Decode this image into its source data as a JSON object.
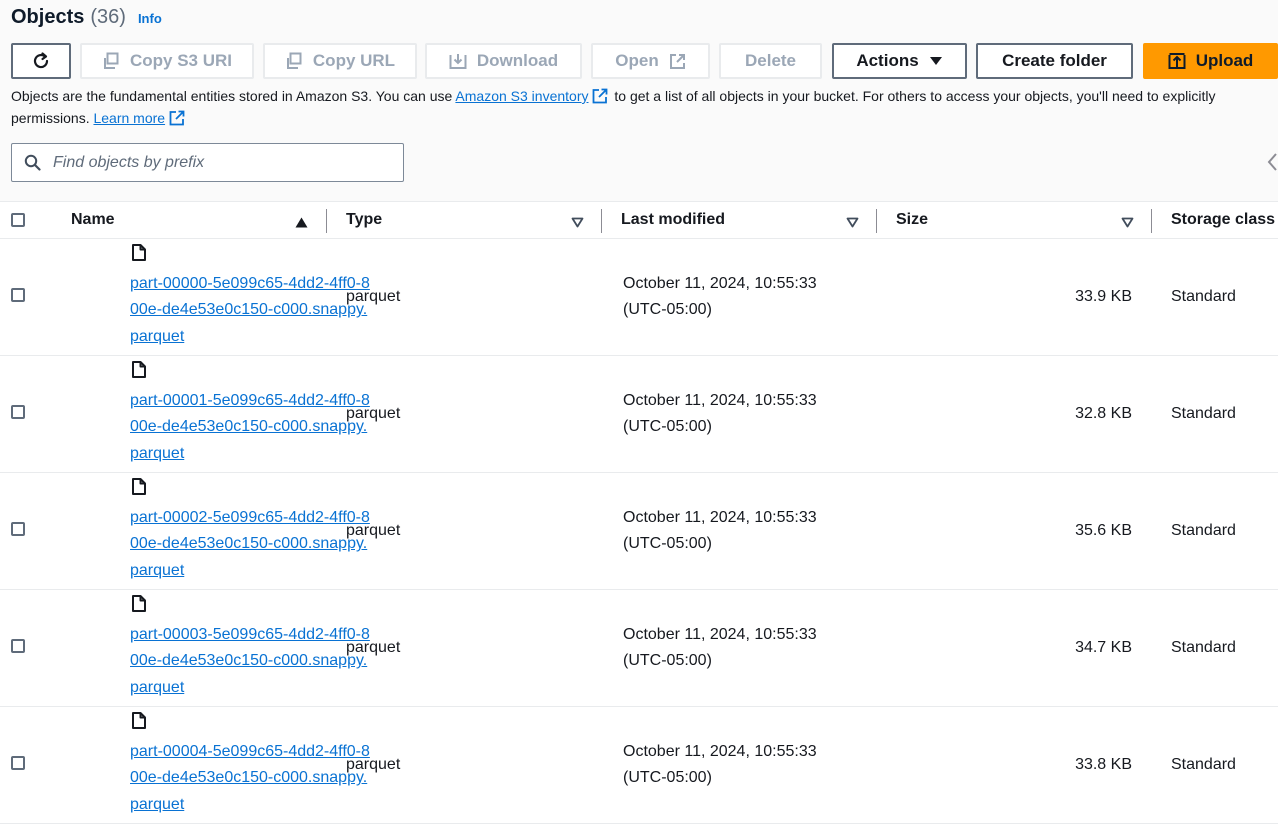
{
  "header": {
    "title": "Objects",
    "count": "(36)",
    "info": "Info"
  },
  "toolbar": {
    "refresh_icon": "refresh-icon",
    "copy_s3_uri": "Copy S3 URI",
    "copy_url": "Copy URL",
    "download": "Download",
    "open": "Open",
    "delete": "Delete",
    "actions": "Actions",
    "create_folder": "Create folder",
    "upload": "Upload"
  },
  "description": {
    "part1": "Objects are the fundamental entities stored in Amazon S3. You can use ",
    "inventory_link": "Amazon S3 inventory",
    "part2": " to get a list of all objects in your bucket. For others to access your objects, you'll need to explicitly",
    "part3": "permissions. ",
    "learn_more": "Learn more"
  },
  "search": {
    "placeholder": "Find objects by prefix"
  },
  "table": {
    "headers": {
      "name": "Name",
      "type": "Type",
      "last_modified": "Last modified",
      "size": "Size",
      "storage_class": "Storage class"
    },
    "rows": [
      {
        "name": "part-00000-5e099c65-4dd2-4ff0-800e-de4e53e0c150-c000.snappy.parquet",
        "type": "parquet",
        "modified_date": "October 11, 2024, 10:55:33",
        "modified_tz": "(UTC-05:00)",
        "size": "33.9 KB",
        "storage_class": "Standard"
      },
      {
        "name": "part-00001-5e099c65-4dd2-4ff0-800e-de4e53e0c150-c000.snappy.parquet",
        "type": "parquet",
        "modified_date": "October 11, 2024, 10:55:33",
        "modified_tz": "(UTC-05:00)",
        "size": "32.8 KB",
        "storage_class": "Standard"
      },
      {
        "name": "part-00002-5e099c65-4dd2-4ff0-800e-de4e53e0c150-c000.snappy.parquet",
        "type": "parquet",
        "modified_date": "October 11, 2024, 10:55:33",
        "modified_tz": "(UTC-05:00)",
        "size": "35.6 KB",
        "storage_class": "Standard"
      },
      {
        "name": "part-00003-5e099c65-4dd2-4ff0-800e-de4e53e0c150-c000.snappy.parquet",
        "type": "parquet",
        "modified_date": "October 11, 2024, 10:55:33",
        "modified_tz": "(UTC-05:00)",
        "size": "34.7 KB",
        "storage_class": "Standard"
      },
      {
        "name": "part-00004-5e099c65-4dd2-4ff0-800e-de4e53e0c150-c000.snappy.parquet",
        "type": "parquet",
        "modified_date": "October 11, 2024, 10:55:33",
        "modified_tz": "(UTC-05:00)",
        "size": "33.8 KB",
        "storage_class": "Standard"
      }
    ]
  },
  "colors": {
    "link": "#0972d3",
    "primary": "#ff9900",
    "text": "#16191f",
    "disabled_text": "#9ba7b6"
  }
}
